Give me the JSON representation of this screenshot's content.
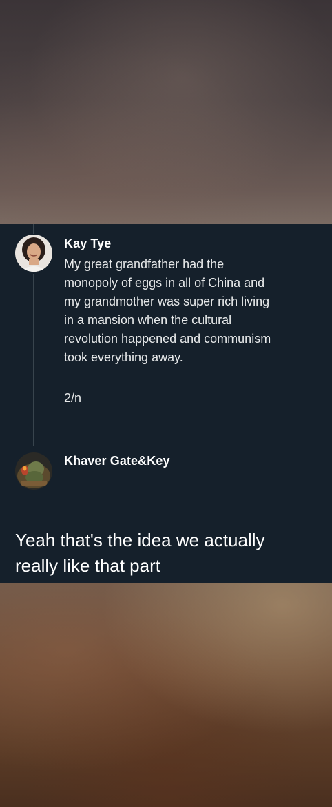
{
  "tweet": {
    "author": "Kay Tye",
    "lines": [
      "My great grandfather had the",
      "monopoly of eggs in all of China and",
      "my grandmother was super rich living",
      "in a mansion when the cultural",
      "revolution happened and communism",
      "took everything away."
    ],
    "thread_count": "2/n"
  },
  "reply": {
    "author": "Khaver Gate&Key"
  },
  "caption": {
    "lines": [
      "Yeah that's the idea we actually",
      "really like that part"
    ]
  }
}
